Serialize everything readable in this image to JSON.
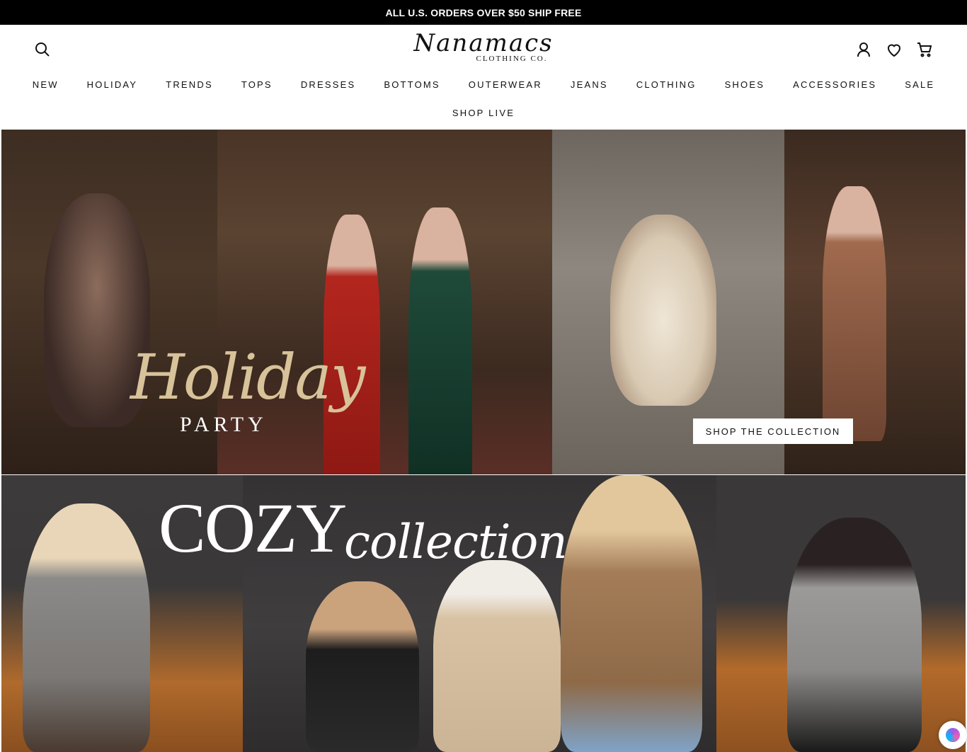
{
  "announcement": {
    "text": "ALL U.S. ORDERS OVER $50 SHIP FREE"
  },
  "header": {
    "logo_script": "Nanamacs",
    "logo_sub": "CLOTHING CO.",
    "icons": [
      "search-icon",
      "account-icon",
      "heart-icon",
      "cart-icon"
    ]
  },
  "nav": {
    "row1": [
      "NEW",
      "HOLIDAY",
      "TRENDS",
      "TOPS",
      "DRESSES",
      "BOTTOMS",
      "OUTERWEAR",
      "JEANS",
      "CLOTHING",
      "SHOES",
      "ACCESSORIES",
      "SALE"
    ],
    "row2": [
      "SHOP LIVE"
    ]
  },
  "hero_holiday": {
    "script": "Holiday",
    "subtitle": "PARTY",
    "cta": "SHOP THE COLLECTION"
  },
  "hero_cozy": {
    "big": "COZY",
    "script": "collection"
  },
  "colors": {
    "announcement_bg": "#000000",
    "gold_script": "#d8c29a"
  }
}
